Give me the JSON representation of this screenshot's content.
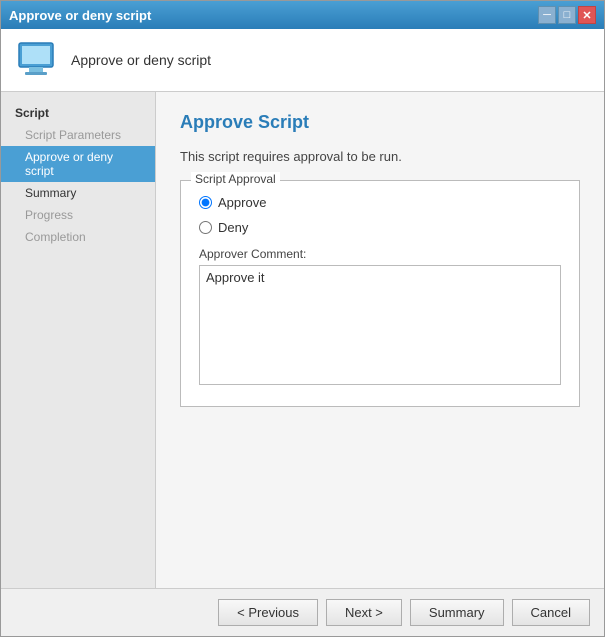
{
  "window": {
    "title": "Approve or deny script",
    "close_btn": "✕",
    "min_btn": "─",
    "max_btn": "□"
  },
  "header": {
    "icon_label": "computer-icon",
    "title": "Approve or deny script"
  },
  "sidebar": {
    "section_script": "Script",
    "item_script_parameters": "Script Parameters",
    "item_approve_deny": "Approve or deny script",
    "item_summary": "Summary",
    "item_progress": "Progress",
    "item_completion": "Completion"
  },
  "main": {
    "title": "Approve Script",
    "info_text": "This script requires approval to be run.",
    "group_label": "Script Approval",
    "approve_label": "Approve",
    "deny_label": "Deny",
    "comment_label": "Approver Comment:",
    "comment_value": "Approve it"
  },
  "footer": {
    "previous_label": "< Previous",
    "next_label": "Next >",
    "summary_label": "Summary",
    "cancel_label": "Cancel"
  }
}
